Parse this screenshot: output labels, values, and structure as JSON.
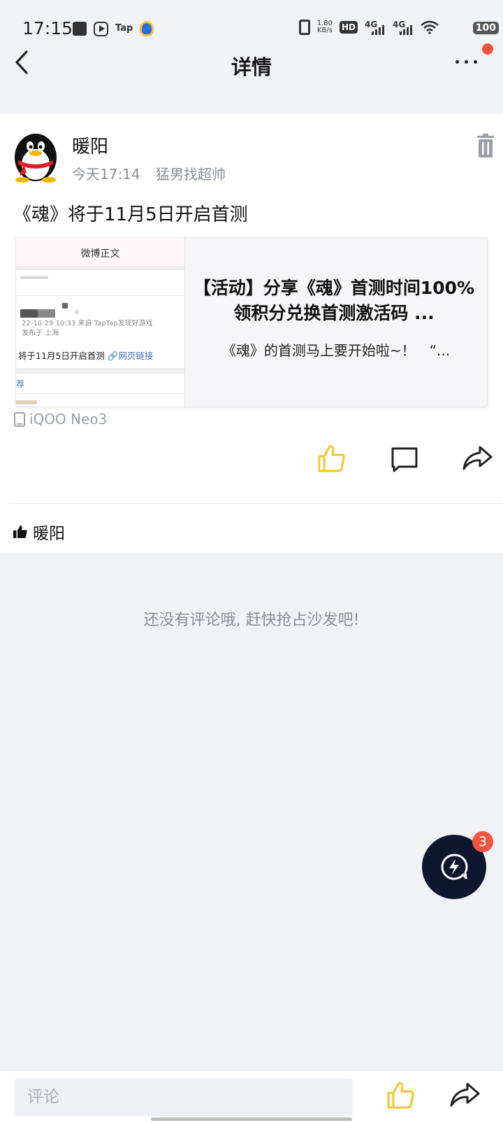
{
  "status_bar": {
    "time": "17:15",
    "tap_label": "Tap",
    "net_speed_value": "1.80",
    "net_speed_unit": "KB/s",
    "hd_label": "HD",
    "sim1_label": "4G",
    "sim2_label": "4G",
    "battery": "100"
  },
  "header": {
    "title": "详情"
  },
  "post": {
    "author": "暖阳",
    "time": "今天17:14",
    "group": "猛男找超帅",
    "text": "《魂》将于11月5日开启首测",
    "device": "iQOO Neo3"
  },
  "link_card": {
    "thumb_header": "微博正文",
    "thumb_date": "22-10-29 10:33  来自 TapTap发现好游戏",
    "thumb_location": "发布于 上海",
    "thumb_text": "将于11月5日开启首测",
    "thumb_link": "🔗网页链接",
    "thumb_rec": "荐",
    "title": "【活动】分享《魂》首测时间100%领积分兑换首测激活码 ...",
    "description": "《魂》的首测马上要开始啦~！　“..."
  },
  "likers": {
    "names": "暖阳"
  },
  "comments": {
    "empty_text": "还没有评论哦, 赶快抢占沙发吧!"
  },
  "fab": {
    "badge_count": "3"
  },
  "bottom_bar": {
    "comment_placeholder": "评论"
  },
  "colors": {
    "like_accent": "#f4c430",
    "badge_red": "#f2533f",
    "fab_bg": "#0f1630",
    "meta_gray": "#8a8e96"
  }
}
